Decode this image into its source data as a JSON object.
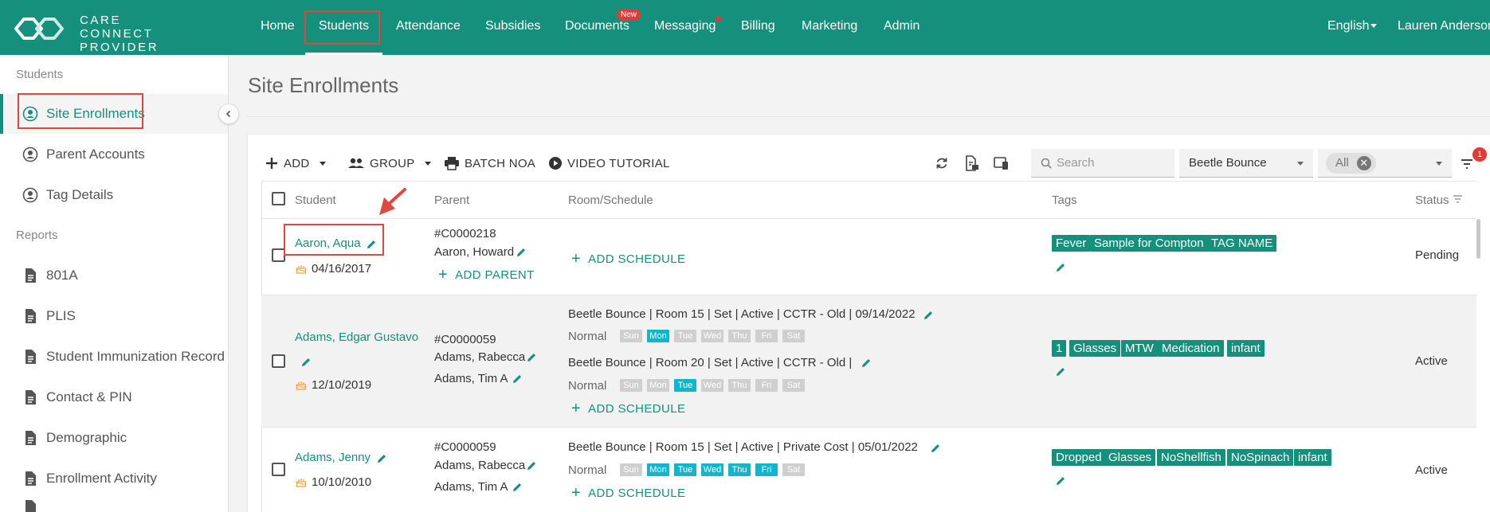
{
  "app": {
    "logo_line1": "CARE",
    "logo_line2": "CONNECT PROVIDER",
    "nav": [
      {
        "label": "Home"
      },
      {
        "label": "Students",
        "active": true
      },
      {
        "label": "Attendance"
      },
      {
        "label": "Subsidies"
      },
      {
        "label": "Documents",
        "badge": "New"
      },
      {
        "label": "Messaging",
        "dot": true
      },
      {
        "label": "Billing"
      },
      {
        "label": "Marketing"
      },
      {
        "label": "Admin"
      }
    ],
    "language": "English",
    "user": "Lauren Anderson",
    "accent_color": "#14907d"
  },
  "sidebar": {
    "sections": [
      {
        "heading": "Students",
        "items": [
          {
            "label": "Site Enrollments",
            "icon": "person-circle-icon",
            "active": true
          },
          {
            "label": "Parent Accounts",
            "icon": "person-circle-icon"
          },
          {
            "label": "Tag Details",
            "icon": "person-circle-icon"
          }
        ]
      },
      {
        "heading": "Reports",
        "items": [
          {
            "label": "801A",
            "icon": "document-icon"
          },
          {
            "label": "PLIS",
            "icon": "document-icon"
          },
          {
            "label": "Student Immunization Record",
            "icon": "document-icon"
          },
          {
            "label": "Contact & PIN",
            "icon": "document-icon"
          },
          {
            "label": "Demographic",
            "icon": "document-icon"
          },
          {
            "label": "Enrollment Activity",
            "icon": "document-icon"
          }
        ]
      }
    ]
  },
  "page": {
    "title": "Site Enrollments"
  },
  "toolbar": {
    "add_label": "ADD",
    "group_label": "GROUP",
    "batch_label": "BATCH NOA",
    "video_label": "VIDEO TUTORIAL",
    "search_placeholder": "Search",
    "site_select": "Beetle Bounce",
    "status_chip": "All",
    "filter_count": "1"
  },
  "table": {
    "columns": [
      "Student",
      "Parent",
      "Room/Schedule",
      "Tags",
      "Status"
    ],
    "add_schedule": "ADD SCHEDULE",
    "add_parent": "ADD PARENT",
    "day_labels": [
      "Sun",
      "Mon",
      "Tue",
      "Wed",
      "Thu",
      "Fri",
      "Sat"
    ],
    "rows": [
      {
        "name": "Aaron, Aqua",
        "dob": "04/16/2017",
        "account": "#C0000218",
        "parents": [
          "Aaron, Howard"
        ],
        "schedules": [],
        "tags": [
          "Fever",
          "Sample for Compton",
          "TAG NAME"
        ],
        "status": "Pending"
      },
      {
        "name": "Adams, Edgar Gustavo",
        "dob": "12/10/2019",
        "account": "#C0000059",
        "parents": [
          "Adams, Rabecca",
          "Adams, Tim A"
        ],
        "schedules": [
          {
            "line": "Beetle Bounce |  Room 15 |  Set   | Active |  CCTR - Old   | 09/14/2022",
            "mode": "Normal",
            "days": [
              false,
              true,
              false,
              false,
              false,
              false,
              false
            ]
          },
          {
            "line": "Beetle Bounce |  Room 20 |  Set   | Active |  CCTR - Old   |",
            "mode": "Normal",
            "days": [
              false,
              false,
              true,
              false,
              false,
              false,
              false
            ]
          }
        ],
        "tags": [
          "1",
          "Glasses",
          "MTW",
          "Medication",
          "infant"
        ],
        "status": "Active"
      },
      {
        "name": "Adams, Jenny",
        "dob": "10/10/2010",
        "account": "#C0000059",
        "parents": [
          "Adams, Rabecca",
          "Adams, Tim A"
        ],
        "schedules": [
          {
            "line": "Beetle Bounce |  Room 15 |  Set   | Active |  Private Cost   | 05/01/2022",
            "mode": "Normal",
            "days": [
              false,
              true,
              true,
              true,
              true,
              true,
              false
            ]
          }
        ],
        "tags": [
          "Dropped",
          "Glasses",
          "NoShellfish",
          "NoSpinach",
          "infant"
        ],
        "status": "Active"
      }
    ]
  }
}
